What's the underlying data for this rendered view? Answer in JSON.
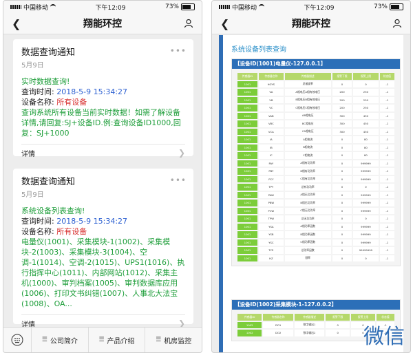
{
  "status": {
    "carrier": "中国移动",
    "time": "下午12:09",
    "battery": "73%",
    "battery_level": 0.73
  },
  "nav": {
    "title": "翔能环控"
  },
  "cards": [
    {
      "title": "数据查询通知",
      "date": "5月9日",
      "heading": "实时数据查询!",
      "query_time_label": "查询时间:",
      "query_time": "2018-5-9 15:34:27",
      "device_label": "设备名称:",
      "device": "所有设备",
      "body": "查询系统所有设备当前实时数据！如需了解设备详情,请回复:SJ+设备ID.例:查询设备ID1000,回复：SJ+1000",
      "footer": "详情"
    },
    {
      "title": "数据查询通知",
      "date": "5月9日",
      "heading": "系统设备列表查询!",
      "query_time_label": "查询时间:",
      "query_time": "2018-5-9 15:34:27",
      "device_label": "设备名称:",
      "device": "所有设备",
      "body": "电量仪(1001)、采集模块-1(1002)、采集模块-2(1003)、采集模块-3(1004)、空调-1(1014)、空调-2(1015)、UPS1(1016)、执行指挥中心(1011)、内部网站(1012)、采集主机(1000)、审判档案(1005)、审判数据库应用(1006)、打印文书纠错(1007)、人事北大法宝(1008)、OA...",
      "footer": "详情"
    }
  ],
  "tabbar": {
    "items": [
      "公司简介",
      "产品介绍",
      "机房监控"
    ]
  },
  "right_page": {
    "title": "系统设备列表查询",
    "section1": {
      "header": "【设备ID(1001)电量仪-127.0.0.1】",
      "columns": [
        "传感器ID",
        "传感器名称",
        "传感器描述",
        "报警下限",
        "报警上限",
        "状态值"
      ],
      "rows": [
        [
          "1001",
          "HGYS",
          "总谐波率",
          "0",
          "0",
          "-1"
        ],
        [
          "1001",
          "VA",
          "A相电压A相有效电压",
          "200",
          "250",
          "-1"
        ],
        [
          "1001",
          "VB",
          "B相电压B相有效电压",
          "200",
          "250",
          "-1"
        ],
        [
          "1001",
          "VC",
          "C相电压C相有效电压",
          "200",
          "250",
          "-1"
        ],
        [
          "1001",
          "VAB",
          "AB相电压",
          "300",
          "450",
          "-1"
        ],
        [
          "1001",
          "VBC",
          "BC相电压",
          "300",
          "450",
          "-1"
        ],
        [
          "1001",
          "VCA",
          "CA相电压",
          "300",
          "450",
          "-1"
        ],
        [
          "1001",
          "IA",
          "A相电流",
          "0",
          "80",
          "-1"
        ],
        [
          "1001",
          "IB",
          "B相电流",
          "0",
          "80",
          "-1"
        ],
        [
          "1001",
          "IC",
          "C相电流",
          "0",
          "80",
          "-1"
        ],
        [
          "1001",
          "PAY",
          "A相有功功率",
          "0",
          "999999",
          "-1"
        ],
        [
          "1001",
          "PBY",
          "B相有功功率",
          "0",
          "999999",
          "-1"
        ],
        [
          "1001",
          "PCY",
          "C相有功功率",
          "0",
          "999999",
          "-1"
        ],
        [
          "1001",
          "TPY",
          "总有功功率",
          "0",
          "0",
          "-1"
        ],
        [
          "1001",
          "PAW",
          "A相无功功率",
          "0",
          "999999",
          "-1"
        ],
        [
          "1001",
          "PBW",
          "B相无功功率",
          "0",
          "999999",
          "-1"
        ],
        [
          "1001",
          "PCW",
          "C相无功功率",
          "0",
          "999999",
          "-1"
        ],
        [
          "1001",
          "TPW",
          "总无功功率",
          "0",
          "0",
          "-1"
        ],
        [
          "1001",
          "YSA",
          "A相功率因数",
          "0",
          "999999",
          "-1"
        ],
        [
          "1001",
          "YSB",
          "B相功率因数",
          "0",
          "999999",
          "-1"
        ],
        [
          "1001",
          "YSC",
          "C相功率因数",
          "0",
          "999999",
          "-1"
        ],
        [
          "1001",
          "TYS",
          "总功率因数",
          "0",
          "99999999",
          "-1"
        ],
        [
          "1001",
          "HZ",
          "频率",
          "0",
          "0",
          "-1"
        ]
      ]
    },
    "section2": {
      "header": "【设备ID(1002)采集模块-1-127.0.0.2】",
      "columns": [
        "传感器ID",
        "传感器名称",
        "传感器描述",
        "报警下限",
        "报警上限",
        "状态值"
      ],
      "rows": [
        [
          "1002",
          "DO1",
          "数字输出1",
          "0",
          "0",
          "-1"
        ],
        [
          "1002",
          "DO2",
          "数字输出2",
          "0",
          "0",
          "-1"
        ]
      ]
    }
  },
  "watermark": "微信"
}
